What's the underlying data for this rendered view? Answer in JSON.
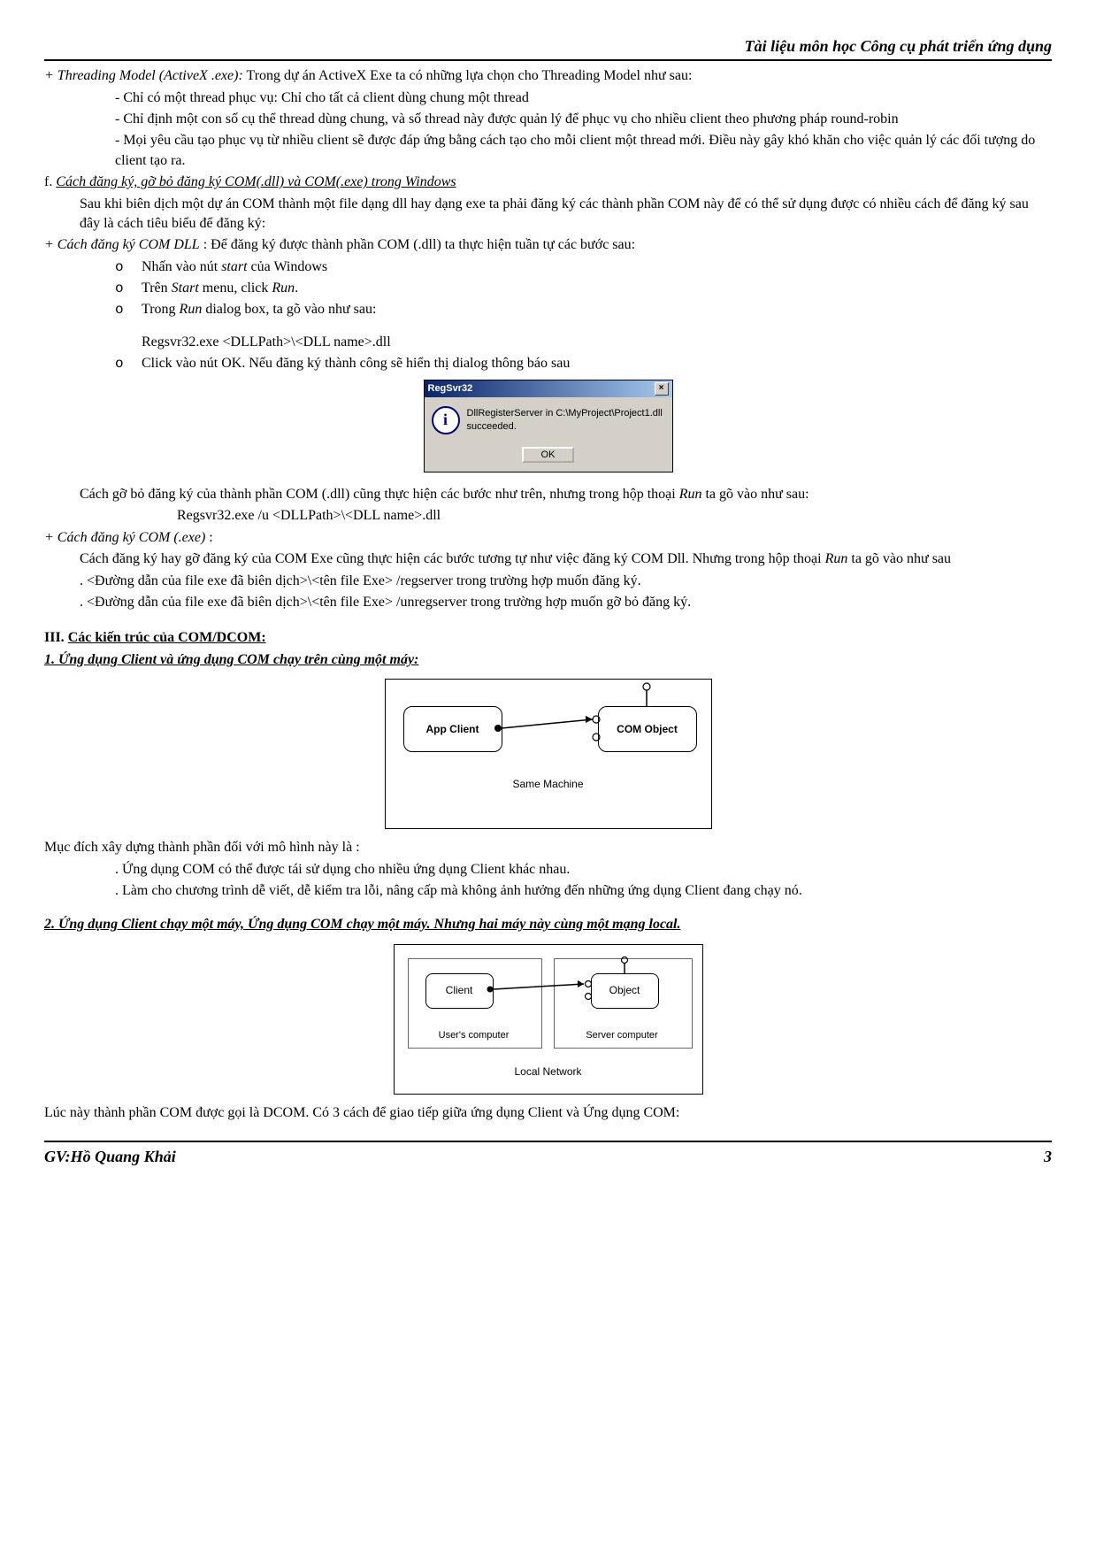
{
  "header": "Tài liệu môn học Công cụ phát triển ứng dụng",
  "s1_lead_i": "+ Threading Model (ActiveX .exe):",
  "s1_lead_r": " Trong dự án ActiveX Exe ta có những lựa chọn cho Threading Model như sau:",
  "b1": "- Chỉ có một thread phục vụ: Chỉ cho tất cả client dùng chung một thread",
  "b2": "- Chỉ định một con số cụ thể thread dùng chung, và số thread này được quản lý để phục vụ cho nhiều client theo phương pháp round-robin",
  "b3": "- Mọi yêu cầu tạo phục vụ từ nhiều client sẽ được đáp ứng bằng cách tạo cho mỗi client một thread mới. Điều này gây khó khăn cho việc quản lý các đối tượng do client tạo ra.",
  "f_head_pre": "f. ",
  "f_head": "Cách đăng ký, gỡ bỏ đăng ký COM(.dll) và COM(.exe) trong Windows",
  "f_p1": "Sau khi biên dịch một dự án COM thành một file dạng dll hay dạng exe ta phải đăng ký các thành phần COM này để có thể sử dụng được có nhiều cách để đăng ký sau đây là cách tiêu biểu để đăng ký:",
  "reg_dll_i": "+ Cách đăng ký COM DLL",
  "reg_dll_r": " : Để đăng ký được thành phần COM (.dll) ta thực hiện tuần tự các bước sau:",
  "o1_a": "Nhấn vào nút ",
  "o1_b": "start",
  "o1_c": " của Windows",
  "o2_a": "Trên ",
  "o2_b": "Start",
  "o2_c": " menu, click ",
  "o2_d": "Run",
  "o2_e": ".",
  "o3_a": "Trong ",
  "o3_b": "Run",
  "o3_c": " dialog box, ta gõ vào như sau:",
  "reg1": "Regsvr32.exe <DLLPath>\\<DLL name>.dll",
  "o4": "Click vào nút OK. Nếu đăng ký thành công sẽ hiển thị dialog thông báo sau",
  "dlg_title": "RegSvr32",
  "dlg_msg": "DllRegisterServer in C:\\MyProject\\Project1.dll succeeded.",
  "dlg_ok": "OK",
  "unreg_p_a": "Cách gỡ bỏ đăng ký của thành phần COM (.dll) cũng thực hiện các bước như trên, nhưng trong hộp thoại ",
  "unreg_p_b": "Run",
  "unreg_p_c": " ta gõ vào như sau:",
  "reg2": "Regsvr32.exe /u  <DLLPath>\\<DLL name>.dll",
  "reg_exe_i": "+ Cách đăng ký COM (.exe)",
  "reg_exe_r": " :",
  "exe_p1_a": "Cách đăng ký hay gỡ đăng ký của COM Exe cũng thực hiện các bước tương tự như việc đăng ký COM Dll. Nhưng trong hộp thoại ",
  "exe_p1_b": "Run",
  "exe_p1_c": " ta gõ vào như sau",
  "exe1": ". <Đường dẫn của file exe đã biên dịch>\\<tên file Exe>  /regserver trong trường hợp muốn đăng ký.",
  "exe2": ". <Đường dẫn của file exe đã biên dịch>\\<tên file Exe>  /unregserver trong trường hợp muốn gỡ bỏ đăng ký.",
  "sec3_pre": "III. ",
  "sec3": "Các kiến trúc của COM/DCOM:",
  "sub1": "1. Ứng dụng Client và ứng dụng COM chạy trên cùng một máy:",
  "d1_client": "App Client",
  "d1_obj": "COM Object",
  "d1_caption": "Same Machine",
  "purpose_h": "Mục đích xây dựng thành phần đối với mô hình này là :",
  "purpose1": ". Ứng dụng COM có thể được tái sử dụng cho nhiều ứng dụng Client khác nhau.",
  "purpose2": ". Làm cho chương trình dễ viết, dễ kiểm tra lỗi, nâng cấp mà không ảnh hưởng đến những ứng dụng Client đang chạy nó.",
  "sub2": "2. Ứng dụng Client chạy một máy, Ứng dụng COM chạy một máy. Nhưng hai máy này cùng một mạng local.",
  "d2_client": "Client",
  "d2_obj": "Object",
  "d2_user": "User's computer",
  "d2_server": "Server computer",
  "d2_caption": "Local Network",
  "dcom_p": "Lúc này thành phần COM được gọi là DCOM. Có 3 cách để giao tiếp giữa ứng dụng Client và Ứng dụng COM:",
  "footer_author": "GV:Hồ Quang Khải",
  "footer_page": "3"
}
